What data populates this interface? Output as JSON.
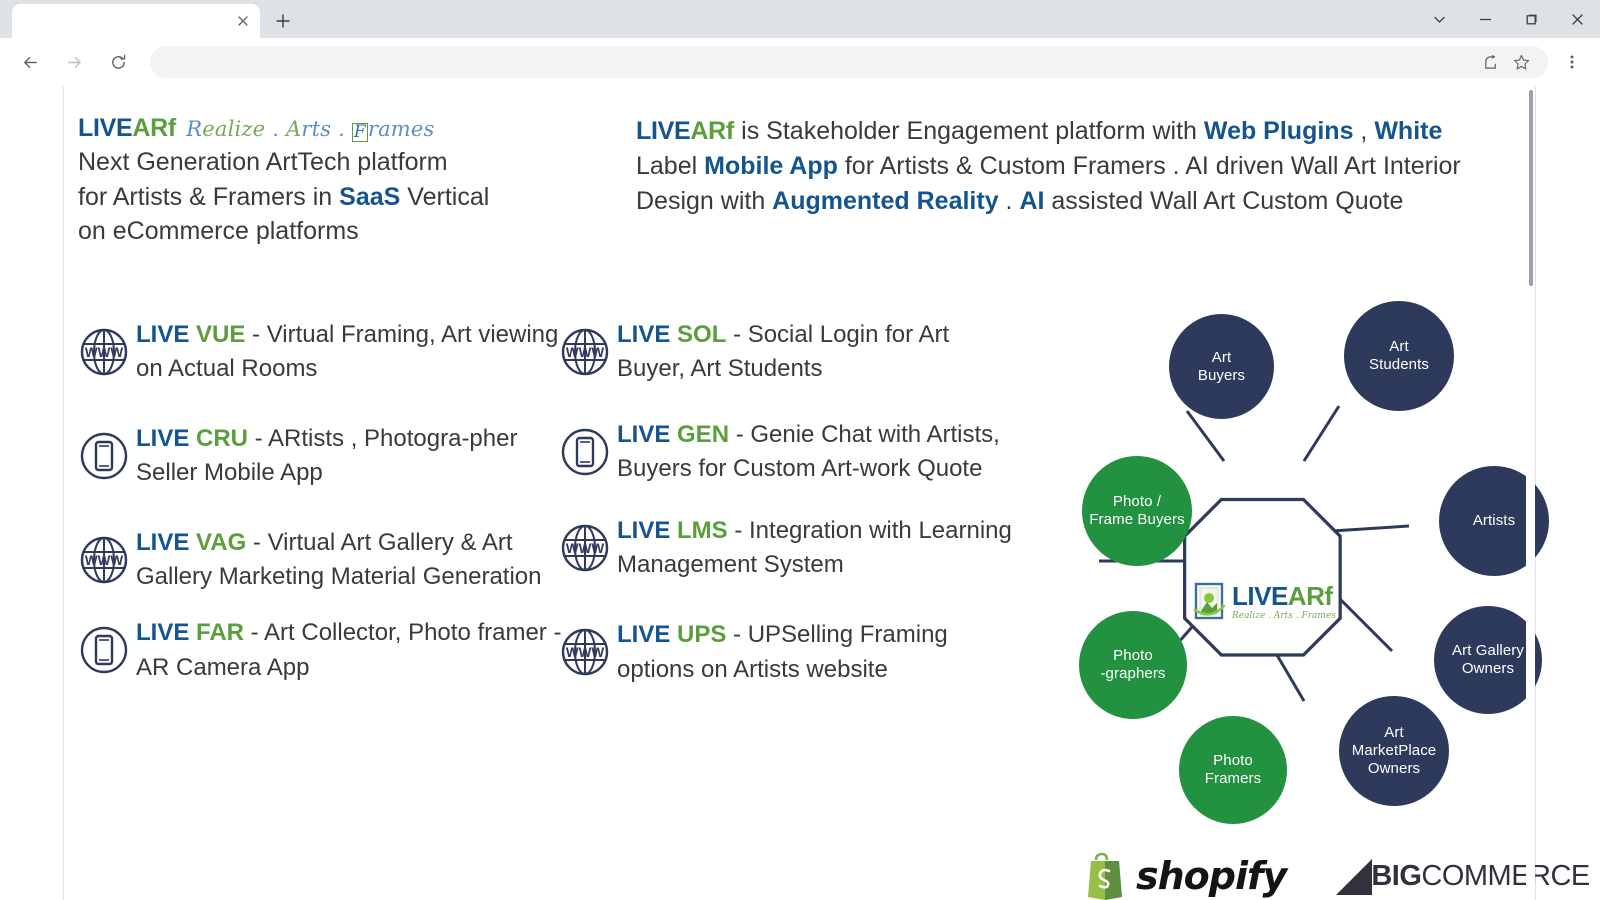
{
  "browser": {
    "tab_title": "",
    "tab_close_icon": "close-icon",
    "new_tab_icon": "plus-icon",
    "window": {
      "expand_icon": "chevron-down-icon",
      "minimize_icon": "minimize-icon",
      "maximize_icon": "maximize-icon",
      "close_icon": "close-icon"
    },
    "toolbar": {
      "back_icon": "back-arrow-icon",
      "forward_icon": "forward-arrow-icon",
      "reload_icon": "reload-icon",
      "url_value": "",
      "url_placeholder": "",
      "share_icon": "share-icon",
      "bookmark_icon": "star-icon",
      "menu_icon": "three-dot-menu-icon"
    }
  },
  "header_left": {
    "brand_live": "LIVE",
    "brand_ar": "AR",
    "brand_f": "f",
    "tagline_r": "R",
    "tagline_ealize": "ealize",
    "tagline_sep1": " . ",
    "tagline_a": "A",
    "tagline_rts": "rts",
    "tagline_sep2": " . ",
    "tagline_fbox": "F",
    "tagline_rames": "rames",
    "line1": "Next Generation ArtTech platform",
    "line2a": "for Artists & Framers  in ",
    "line2b": "SaaS",
    "line2c": " Vertical",
    "line3": "on eCommerce platforms"
  },
  "header_right": {
    "brand_live": "LIVE",
    "brand_ar": "AR",
    "brand_f": "f",
    "p1": " is  Stakeholder Engagement platform with ",
    "b1": "Web Plugins",
    "p2": " , ",
    "b2": "White",
    "p3": " Label ",
    "b3": "Mobile App",
    "p4": " for Artists & Custom Framers . AI driven Wall Art Interior Design with ",
    "b4": "Augmented Reality",
    "p5": " . ",
    "b5": "AI",
    "p6": " assisted Wall Art Custom Quote"
  },
  "features_left": [
    {
      "icon": "globe-www-icon",
      "live": "LIVE",
      "code": "VUE",
      "desc": " - Virtual Framing, Art viewing on Actual Rooms"
    },
    {
      "icon": "mobile-phone-icon",
      "live": "LIVE",
      "code": "CRU",
      "desc": " - ARtists , Photogra-pher Seller Mobile App"
    },
    {
      "icon": "globe-www-icon",
      "live": "LIVE",
      "code": "VAG",
      "desc": " - Virtual Art Gallery & Art Gallery Marketing Material Generation"
    },
    {
      "icon": "mobile-phone-icon",
      "live": "LIVE",
      "code": "FAR",
      "desc": " - Art Collector, Photo framer - AR Camera App"
    }
  ],
  "features_mid": [
    {
      "icon": "globe-www-icon",
      "live": "LIVE",
      "code": "SOL",
      "desc": " - Social Login for Art Buyer, Art Students"
    },
    {
      "icon": "mobile-phone-icon",
      "live": "LIVE",
      "code": "GEN",
      "desc": " - Genie Chat with Artists, Buyers for Custom Art-work Quote"
    },
    {
      "icon": "globe-www-icon",
      "live": "LIVE",
      "code": "LMS",
      "desc": " - Integration with Learning Management System"
    },
    {
      "icon": "globe-www-icon",
      "live": "LIVE",
      "code": "UPS",
      "desc": " - UPSelling Framing options on Artists website"
    }
  ],
  "diagram": {
    "center_brand_live": "LIVE",
    "center_brand_ar": "AR",
    "center_brand_f": "f",
    "center_tagline": "Realize . Arts . Frames",
    "colors": {
      "navy": "#2e3a5c",
      "green": "#229140"
    },
    "nodes": [
      {
        "label": "Art\nBuyers",
        "color": "navy"
      },
      {
        "label": "Art\nStudents",
        "color": "navy"
      },
      {
        "label": "Artists",
        "color": "navy"
      },
      {
        "label": "Art Gallery\nOwners",
        "color": "navy"
      },
      {
        "label": "Art\nMarketPlace\nOwners",
        "color": "navy"
      },
      {
        "label": "Photo\nFramers",
        "color": "green"
      },
      {
        "label": "Photo\n-graphers",
        "color": "green"
      },
      {
        "label": "Photo /\nFrame Buyers",
        "color": "green"
      }
    ]
  },
  "platform_logos": {
    "shopify_name": "shopify",
    "shopify_icon": "shopify-bag-icon",
    "bigcommerce_big": "BIG",
    "bigcommerce_commerce": "COMMERCE",
    "bigcommerce_icon": "bigcommerce-mark-icon"
  }
}
